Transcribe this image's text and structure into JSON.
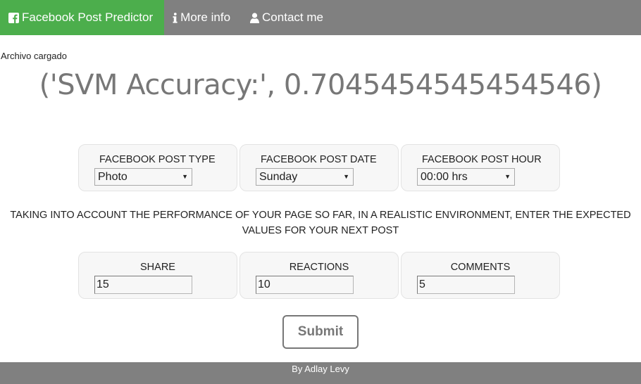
{
  "nav": {
    "items": [
      {
        "label": "Facebook Post Predictor",
        "icon": "facebook-icon",
        "active": true
      },
      {
        "label": "More info",
        "icon": "info-icon"
      },
      {
        "label": "Contact me",
        "icon": "user-icon"
      }
    ],
    "active_color": "#4cae4c",
    "bar_color": "#808080"
  },
  "status": {
    "uploaded": "Archivo cargado"
  },
  "accuracy": {
    "text": "('SVM Accuracy:', 0.7045454545454546)"
  },
  "post_options": {
    "type": {
      "label": "FACEBOOK POST TYPE",
      "value": "Photo"
    },
    "date": {
      "label": "FACEBOOK POST DATE",
      "value": "Sunday"
    },
    "hour": {
      "label": "FACEBOOK POST HOUR",
      "value": "00:00 hrs"
    }
  },
  "instructions": {
    "line1": "TAKING INTO ACCOUNT THE PERFORMANCE OF YOUR PAGE SO FAR, IN A REALISTIC ENVIRONMENT, ENTER THE EXPECTED",
    "line2": "VALUES FOR YOUR NEXT POST"
  },
  "expected": {
    "share": {
      "label": "SHARE",
      "value": "15"
    },
    "reactions": {
      "label": "REACTIONS",
      "value": "10"
    },
    "comments": {
      "label": "COMMENTS",
      "value": "5"
    }
  },
  "form": {
    "submit_label": "Submit"
  },
  "footer": {
    "text": "By Adlay Levy"
  }
}
